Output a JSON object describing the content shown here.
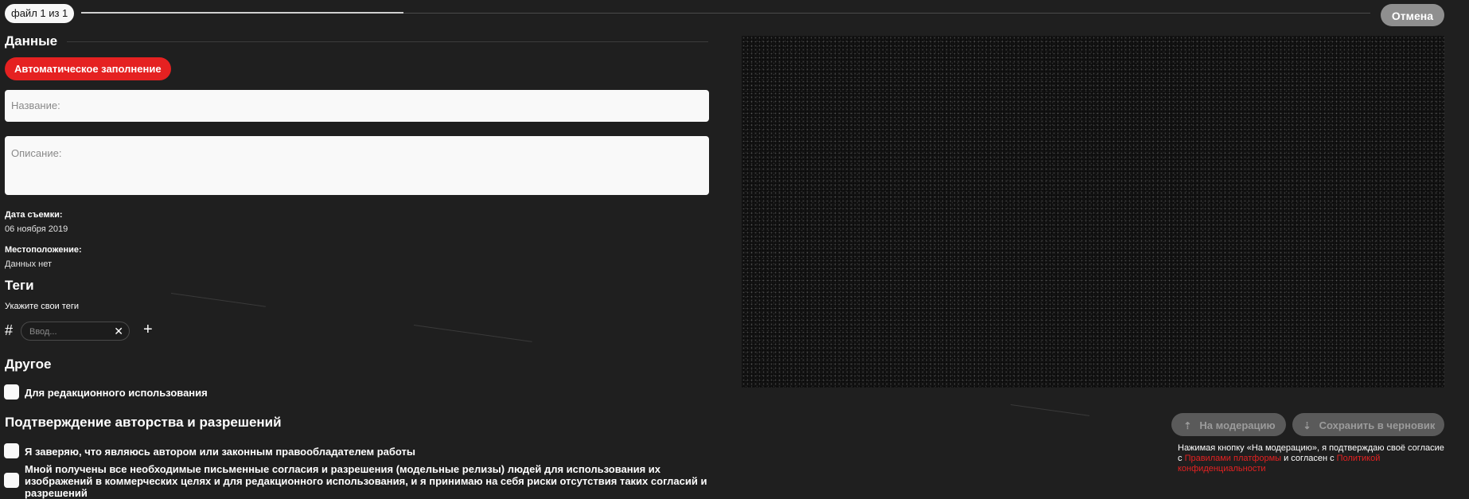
{
  "header": {
    "file_counter": "файл 1 из 1",
    "progress": 0.25,
    "cancel_label": "Отмена"
  },
  "data_section": {
    "title": "Данные",
    "auto_fill_label": "Автоматическое заполнение",
    "name_placeholder": "Название:",
    "description_placeholder": "Описание:",
    "shoot_date_label": "Дата съемки:",
    "shoot_date_value": "06 ноября 2019",
    "location_label": "Местоположение:",
    "location_value": "Данных нет"
  },
  "tags_section": {
    "title": "Теги",
    "hint": "Укажите свои теги",
    "hash_symbol": "#",
    "input_placeholder": "Ввод...",
    "clear_symbol": "✕",
    "add_symbol": "+"
  },
  "other_section": {
    "title": "Другое",
    "editorial_label": "Для редакционного использования"
  },
  "rights_section": {
    "title": "Подтверждение авторства и разрешений",
    "author_label": "Я заверяю, что являюсь автором или законным правообладателем работы",
    "consents_label": "Мной получены все необходимые письменные согласия и разрешения (модельные релизы) людей для использования их изображений в коммерческих целях и для редакционного использования, и я принимаю на себя риски отсутствия таких согласий и разрешений"
  },
  "actions": {
    "moderation_label": "На модерацию",
    "draft_label": "Сохранить в черновик",
    "consent_text_1": "Нажимая кнопку «На модерацию», я подтверждаю своё согласие с ",
    "rules_link": "Правилами платформы",
    "consent_text_2": " и согласен с ",
    "privacy_link": "Политикой конфиденциальности"
  },
  "icons": {
    "upload": "upload-icon",
    "download": "download-icon"
  },
  "colors": {
    "background": "#1f1f1f",
    "accent_red": "#e52121",
    "field_bg": "#f9f9f9",
    "disabled_btn": "#5a5a5a",
    "cancel_btn": "#8f8f8f"
  }
}
